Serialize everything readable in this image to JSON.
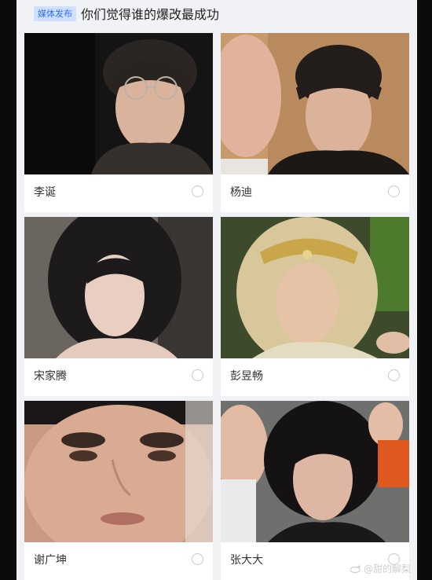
{
  "header": {
    "badge": "媒体发布",
    "title": "你们觉得谁的爆改最成功"
  },
  "options": [
    {
      "name": "李诞",
      "photo": "portrait-glasses"
    },
    {
      "name": "杨迪",
      "photo": "portrait-two-faces"
    },
    {
      "name": "宋家腾",
      "photo": "portrait-long-hair"
    },
    {
      "name": "彭昱畅",
      "photo": "portrait-gold-crown"
    },
    {
      "name": "谢广坤",
      "photo": "portrait-closeup"
    },
    {
      "name": "张大大",
      "photo": "portrait-wuxia"
    }
  ],
  "watermark": {
    "text": "@甜的解梨"
  },
  "colors": {
    "accent": "#2f6ff0",
    "badge_bg": "#cfe0ff",
    "panel_bg": "#f1f2f5"
  }
}
